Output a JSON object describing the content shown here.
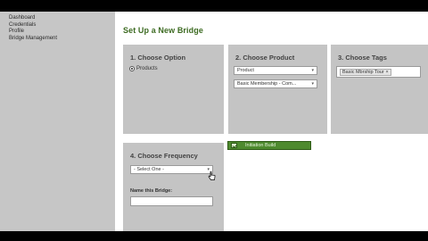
{
  "sidebar": {
    "items": [
      {
        "label": "Dashboard"
      },
      {
        "label": "Credentials"
      },
      {
        "label": "Profile"
      },
      {
        "label": "Bridge Management"
      }
    ]
  },
  "page": {
    "title": "Set Up a New Bridge"
  },
  "panels": {
    "option": {
      "title": "1. Choose Option",
      "radio_label": "Products"
    },
    "product": {
      "title": "2. Choose Product",
      "product_select": "Product",
      "membership_select": "Basic Membership - Com..."
    },
    "tags": {
      "title": "3. Choose Tags",
      "tag": "Basic Mbrship Tour",
      "remove_glyph": "×"
    },
    "frequency": {
      "title": "4. Choose Frequency",
      "select_value": "- Select One -",
      "name_label": "Name this Bridge:"
    }
  },
  "action_button": {
    "label": "Initiation Build"
  },
  "icons": {
    "chevron": "▾"
  },
  "colors": {
    "accent_green": "#3d6b22",
    "button_green": "#4e8a2e",
    "panel_gray": "#c4c4c4",
    "sidebar_gray": "#c6c6c6"
  }
}
